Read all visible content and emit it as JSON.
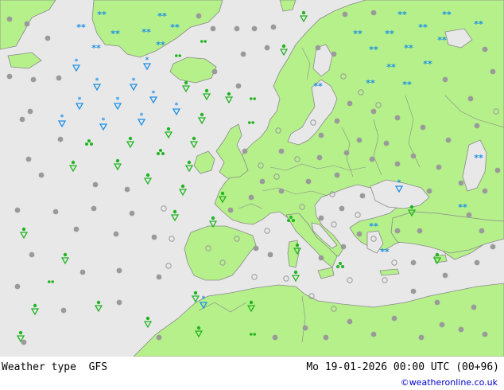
{
  "footer": {
    "product_label": "Weather type",
    "model": "GFS",
    "valid_time": "Mo 19-01-2026 00:00 UTC (00+96)",
    "credit": "©weatheronline.co.uk"
  },
  "colors": {
    "sea": "#e8e8e8",
    "land": "#b5f08a",
    "border": "#888888",
    "snow": "#1e90e6",
    "rain": "#22b422",
    "dry": "#9a9a9a"
  },
  "symbol_types": [
    "snow",
    "snow-shower",
    "rain",
    "rain-shower",
    "drizzle",
    "cloud-dry",
    "fair"
  ]
}
